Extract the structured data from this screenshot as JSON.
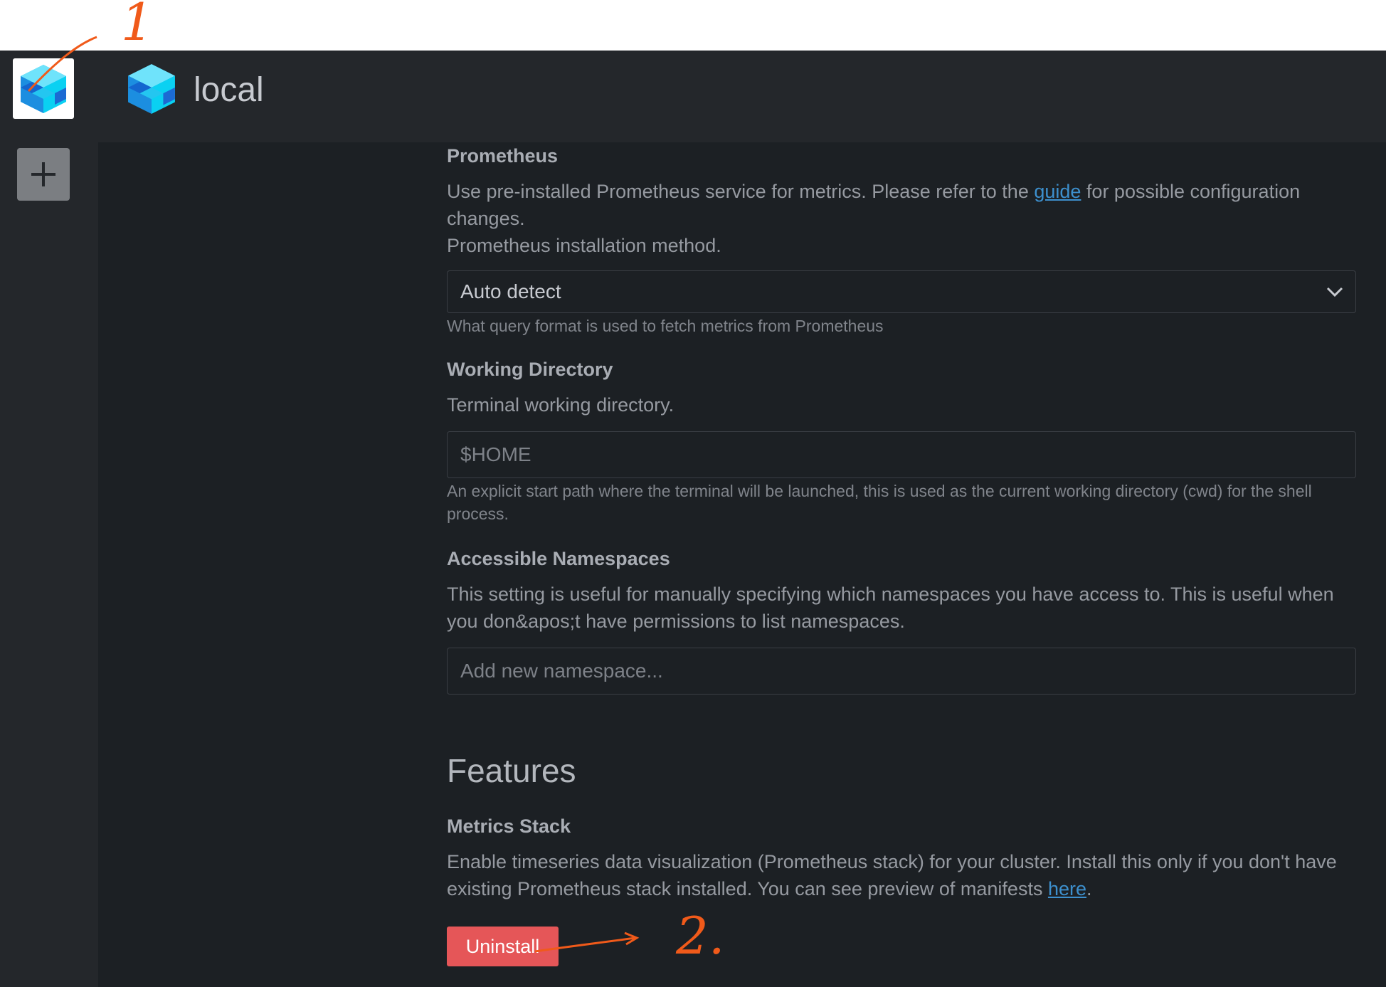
{
  "cluster": {
    "name": "local"
  },
  "prometheus": {
    "title": "Prometheus",
    "desc_before_link": "Use pre-installed Prometheus service for metrics. Please refer to the ",
    "link_text": "guide",
    "desc_after_link": " for possible configuration changes.",
    "method_label": "Prometheus installation method.",
    "select_value": "Auto detect",
    "select_hint": "What query format is used to fetch metrics from Prometheus"
  },
  "working_directory": {
    "title": "Working Directory",
    "desc": "Terminal working directory.",
    "placeholder": "$HOME",
    "hint": "An explicit start path where the terminal will be launched, this is used as the current working directory (cwd) for the shell process."
  },
  "namespaces": {
    "title": "Accessible Namespaces",
    "desc": "This setting is useful for manually specifying which namespaces you have access to. This is useful when you don&apos;t have permissions to list namespaces.",
    "placeholder": "Add new namespace..."
  },
  "features": {
    "heading": "Features",
    "metrics_title": "Metrics Stack",
    "metrics_desc_before_link": "Enable timeseries data visualization (Prometheus stack) for your cluster. Install this only if you don't have existing Prometheus stack installed. You can see preview of manifests ",
    "metrics_link_text": "here",
    "metrics_desc_after_link": ".",
    "button_label": "Uninstall"
  },
  "annotations": {
    "label_1": "1",
    "label_2": "2."
  },
  "colors": {
    "accent_link": "#3d90ce",
    "danger_button": "#e55658",
    "annotation": "#f05a1a"
  }
}
